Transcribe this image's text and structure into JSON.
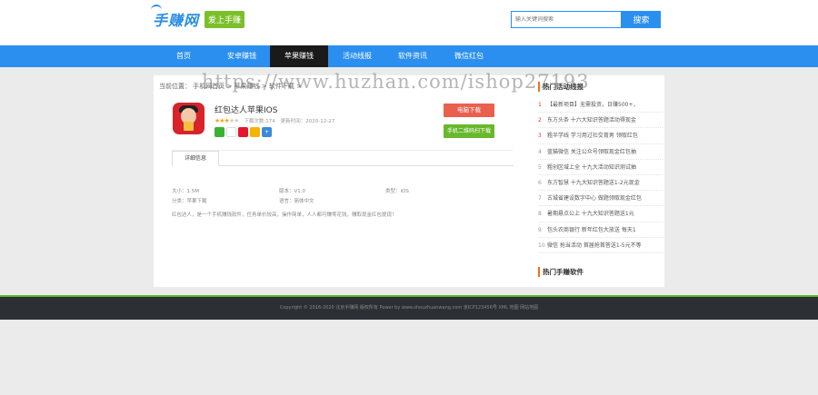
{
  "logo": {
    "text": "手赚网",
    "badge": "爱上手赚"
  },
  "search": {
    "placeholder": "输入关键词搜索",
    "button": "搜索"
  },
  "nav": [
    {
      "label": "首页"
    },
    {
      "label": "安卓赚钱"
    },
    {
      "label": "苹果赚钱"
    },
    {
      "label": "活动线报"
    },
    {
      "label": "软件资讯"
    },
    {
      "label": "微信红包"
    }
  ],
  "breadcrumb": "当前位置： 手机网首页 > 苹果赚钱 > 软件下载 >",
  "app": {
    "title": "红包达人苹果IOS",
    "stars_on": "★★★",
    "stars_off": "★★",
    "downloads": "下载次数:174",
    "updated": "更新时间：2020-12-27",
    "download_button": "电脑下载",
    "qr_button": "手机二维码扫下载"
  },
  "tab": "详细信息",
  "info": {
    "size": "大小：1.5M",
    "version": "版本：V1.0",
    "type": "类型：iOS",
    "category": "分类：苹果下载",
    "language": "语言：简体中文"
  },
  "description": "红包达人，是一个手机赚钱软件，任务单价较高，操作简单，人人都可赚零花钱，赚取现金红包提现！",
  "sidebar": {
    "title": "热门活动线报",
    "title2": "热门手赚软件",
    "items": [
      {
        "num": "1",
        "text": "【最新项目】无需投资，日赚500+，"
      },
      {
        "num": "2",
        "text": "东方头条 十六大知识答题活动得现金"
      },
      {
        "num": "3",
        "text": "粗半学线 学习用过社交育男 领取红包"
      },
      {
        "num": "4",
        "text": "蓝猫微信 关注公众号领取现金红包抽"
      },
      {
        "num": "5",
        "text": "粗创区域上全 十九大活动知识测试抽"
      },
      {
        "num": "6",
        "text": "东方智慧 十九大知识答题送1-2元现金"
      },
      {
        "num": "7",
        "text": "古城省建设数字中心 做题领取现金红包"
      },
      {
        "num": "8",
        "text": "暑期悬点公上 十九大知识答题送1元"
      },
      {
        "num": "9",
        "text": "包头农商银行 新年红包大放送 每天1"
      },
      {
        "num": "10",
        "text": "微信 抢当活动 首届抢首答送1-5元不等"
      }
    ]
  },
  "footer": "Copyright © 2016-2020 北京手赚网 版权所有 Power by www.shouzhuanwang.com 京ICP123456号 XML 地图 网站地图",
  "watermark": "https://www.huzhan.com/ishop27193",
  "colors": {
    "nav": "#2b8ff0",
    "nav_active": "#1a1a1a",
    "download": "#e9604f",
    "qr": "#68b82d",
    "footer": "#2c2f33",
    "footer_border": "#5cb531",
    "rank_hot": "#e8322c"
  }
}
